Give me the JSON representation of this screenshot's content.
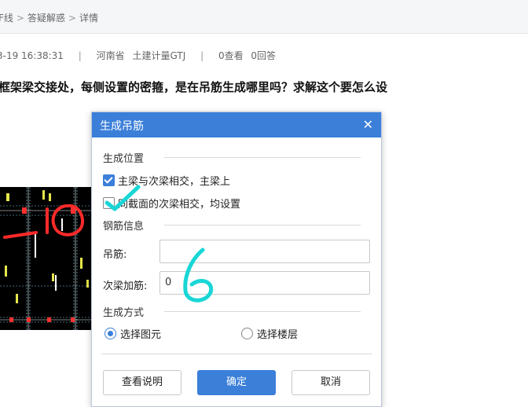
{
  "breadcrumb": {
    "items": [
      "F线",
      "答疑解惑",
      "详情"
    ],
    "separator": ">"
  },
  "meta": {
    "datetime": "3-19 16:38:31",
    "province": "河南省",
    "category": "土建计量GTJ",
    "views": "0查看",
    "answers": "0回答"
  },
  "question": {
    "text": "框架梁交接处，每侧设置的密箍，是在吊筋生成哪里吗？求解这个要怎么设"
  },
  "dialog": {
    "title": "生成吊筋",
    "close_icon": "close-icon",
    "position_group": "生成位置",
    "checkbox1": {
      "label": "主梁与次梁相交，主梁上",
      "checked": true
    },
    "checkbox2": {
      "label": "同截面的次梁相交，均设置",
      "checked": false
    },
    "rebar_group": "钢筋信息",
    "hanger_label": "吊筋:",
    "hanger_value": "",
    "secondary_label": "次梁加筋:",
    "secondary_value": "0",
    "mode_group": "生成方式",
    "radio1": {
      "label": "选择图元",
      "selected": true
    },
    "radio2": {
      "label": "选择楼层",
      "selected": false
    },
    "help_button": "查看说明",
    "ok_button": "确定",
    "cancel_button": "取消"
  },
  "colors": {
    "accent": "#3b7fd9",
    "annotation_red": "#ff2a2a",
    "annotation_cyan": "#19d6d6"
  }
}
